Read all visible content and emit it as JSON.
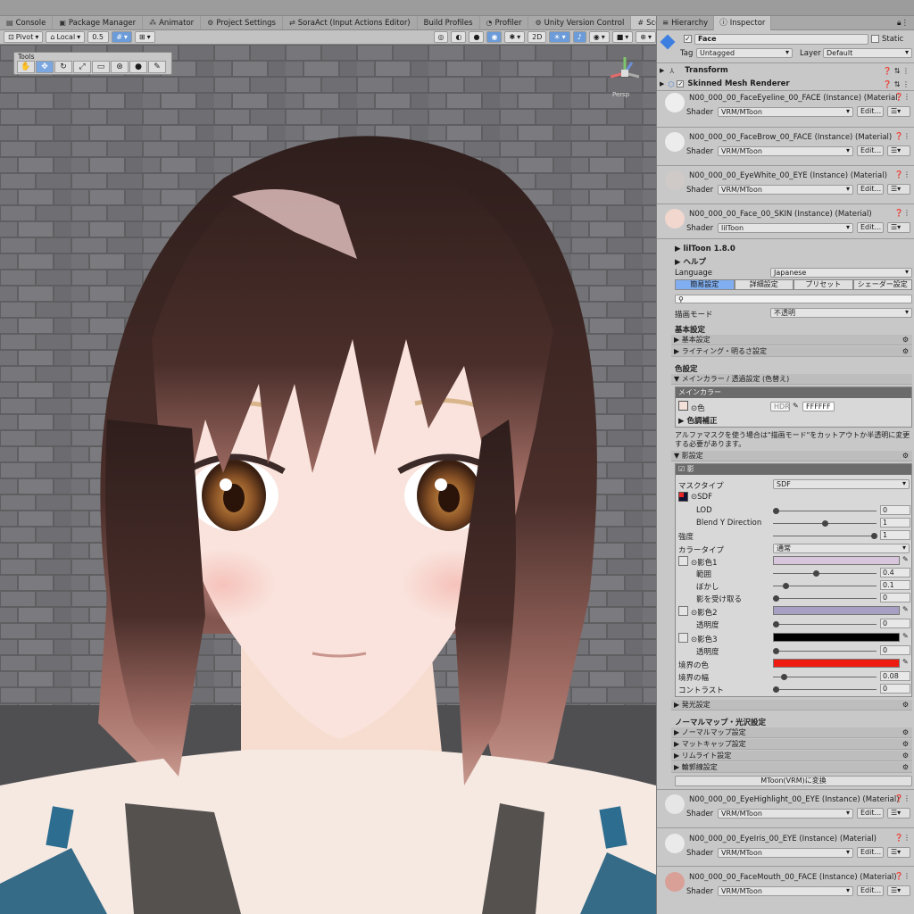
{
  "tabs": [
    {
      "label": "Console",
      "icon": "console-icon"
    },
    {
      "label": "Package Manager",
      "icon": "package-icon"
    },
    {
      "label": "Animator",
      "icon": "animator-icon"
    },
    {
      "label": "Project Settings",
      "icon": "gear-icon"
    },
    {
      "label": "SoraAct (Input Actions Editor)",
      "icon": "input-icon"
    },
    {
      "label": "Build Profiles",
      "icon": "build-icon"
    },
    {
      "label": "Profiler",
      "icon": "profiler-icon"
    },
    {
      "label": "Unity Version Control",
      "icon": "vcs-icon"
    },
    {
      "label": "Scene",
      "icon": "scene-icon"
    }
  ],
  "scene_toolbar": {
    "pivot": "Pivot",
    "local": "Local",
    "snap": "0.5",
    "mode2d": "2D"
  },
  "tools_overlay": {
    "title": "Tools"
  },
  "gizmo": {
    "label": "Persp"
  },
  "panel_tabs": {
    "hierarchy": "Hierarchy",
    "inspector": "Inspector"
  },
  "object": {
    "name": "Face",
    "static_label": "Static",
    "tag_label": "Tag",
    "tag": "Untagged",
    "layer_label": "Layer",
    "layer": "Default"
  },
  "components": {
    "transform": "Transform",
    "smr": "Skinned Mesh Renderer"
  },
  "shader_label": "Shader",
  "edit_label": "Edit...",
  "materials_top": [
    {
      "name": "N00_000_00_FaceEyeline_00_FACE (Instance) (Material)",
      "shader": "VRM/MToon"
    },
    {
      "name": "N00_000_00_FaceBrow_00_FACE (Instance) (Material)",
      "shader": "VRM/MToon"
    },
    {
      "name": "N00_000_00_EyeWhite_00_EYE (Instance) (Material)",
      "shader": "VRM/MToon"
    },
    {
      "name": "N00_000_00_Face_00_SKIN (Instance) (Material)",
      "shader": "lilToon"
    }
  ],
  "liltoon": {
    "version": "lilToon 1.8.0",
    "help": "ヘルプ",
    "language_label": "Language",
    "language": "Japanese",
    "mode_tabs": [
      "簡易設定",
      "詳細設定",
      "プリセット",
      "シェーダー設定"
    ],
    "render_label": "描画モード",
    "render_mode": "不透明",
    "basic_header": "基本設定",
    "basic_folds": [
      "基本設定",
      "ライティング・明るさ設定"
    ],
    "color_header": "色設定",
    "main_fold": "メインカラー / 透過設定 (色替え)",
    "main_color_title": "メインカラー",
    "color_label": "色",
    "hdr": "HDR",
    "hex": "FFFFFF",
    "tone_correction": "色調補正",
    "note": "アルファマスクを使う場合は\"描画モード\"をカットアウトか半透明に変更する必要があります。",
    "shadow_fold": "影設定",
    "shadow_toggle": "影",
    "mask_type_label": "マスクタイプ",
    "mask_type": "SDF",
    "sdf_label": "SDF",
    "lod_label": "LOD",
    "lod": "0",
    "blend_label": "Blend Y Direction",
    "blend": "1",
    "strength_label": "強度",
    "strength": "1",
    "color_type_label": "カラータイプ",
    "color_type": "通常",
    "shadow1_label": "影色1",
    "range_label": "範囲",
    "range": "0.4",
    "blur_label": "ぼかし",
    "blur": "0.1",
    "receive_label": "影を受け取る",
    "receive": "0",
    "shadow2_label": "影色2",
    "alpha_label": "透明度",
    "alpha2": "0",
    "shadow3_label": "影色3",
    "alpha3": "0",
    "border_color_label": "境界の色",
    "border_width_label": "境界の幅",
    "border_width": "0.08",
    "contrast_label": "コントラスト",
    "contrast": "0",
    "emission_fold": "発光設定",
    "normal_header": "ノーマルマップ・光沢設定",
    "normal_folds": [
      "ノーマルマップ設定",
      "マットキャップ設定",
      "リムライト設定",
      "輪郭線設定"
    ],
    "convert_button": "MToon(VRM)に変換"
  },
  "materials_bottom": [
    {
      "name": "N00_000_00_EyeHighlight_00_EYE (Instance) (Material)",
      "shader": "VRM/MToon"
    },
    {
      "name": "N00_000_00_EyeIris_00_EYE (Instance) (Material)",
      "shader": "VRM/MToon"
    },
    {
      "name": "N00_000_00_FaceMouth_00_FACE (Instance) (Material)",
      "shader": "VRM/MToon"
    }
  ],
  "colors": {
    "accent": "#4a7fd1",
    "shadow1": "#d8c7dc",
    "shadow2": "#a79fc4",
    "shadow3": "#000000",
    "border": "#ee1c10"
  }
}
